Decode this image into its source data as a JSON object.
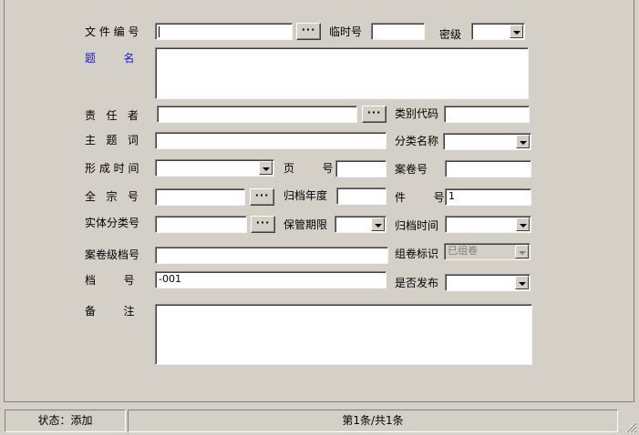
{
  "form": {
    "file_no": {
      "label": "文 件 编 号",
      "value": ""
    },
    "temp_no": {
      "label": "临时号",
      "value": ""
    },
    "security": {
      "label": "密级",
      "value": ""
    },
    "title": {
      "label": "题        名",
      "value": ""
    },
    "responsible": {
      "label": "责   任   者",
      "value": ""
    },
    "category_code": {
      "label": "类别代码",
      "value": ""
    },
    "subject": {
      "label": "主   题   词",
      "value": ""
    },
    "category_name": {
      "label": "分类名称",
      "value": ""
    },
    "form_time": {
      "label": "形 成 时 间",
      "value": ""
    },
    "page": {
      "label": "页        号",
      "value": ""
    },
    "volume_no": {
      "label": "案卷号",
      "value": ""
    },
    "fonds_no": {
      "label": "全   宗   号",
      "value": ""
    },
    "archive_year": {
      "label": "归档年度",
      "value": ""
    },
    "item_no": {
      "label": "件        号",
      "value": "1"
    },
    "entity_class_no": {
      "label": "实体分类号",
      "value": ""
    },
    "retention": {
      "label": "保管期限",
      "value": ""
    },
    "archive_time": {
      "label": "归档时间",
      "value": ""
    },
    "volume_level_no": {
      "label": "案卷级档号",
      "value": ""
    },
    "group_flag": {
      "label": "组卷标识",
      "value": "已组卷"
    },
    "archive_no": {
      "label": "档        号",
      "value": "-001"
    },
    "published": {
      "label": "是否发布",
      "value": ""
    },
    "remarks": {
      "label": "备        注",
      "value": ""
    }
  },
  "browse_label": "···",
  "statusbar": {
    "state": "状态：添加",
    "record": "第1条/共1条"
  }
}
